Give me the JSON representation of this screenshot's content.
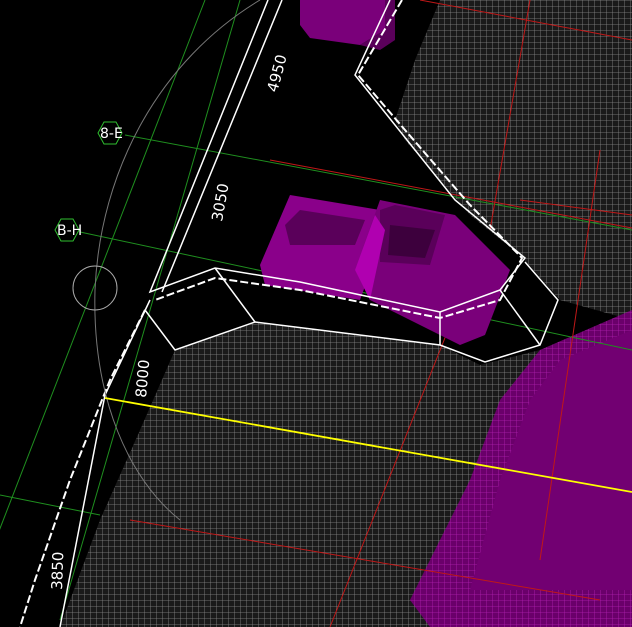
{
  "grid_labels": {
    "row_8e": "8-E",
    "row_bh": "B-H"
  },
  "dimensions": {
    "d_4950": "4950",
    "d_3050": "3050",
    "d_8000": "8000",
    "d_3850": "3850"
  },
  "colors": {
    "background": "#000000",
    "grid_green": "#1f8f1f",
    "grid_red": "#c01818",
    "edge_white": "#ffffff",
    "slab_magenta": "#7a007a",
    "highlight_magenta": "#b000b0",
    "alignment_yellow": "#ffff00"
  }
}
